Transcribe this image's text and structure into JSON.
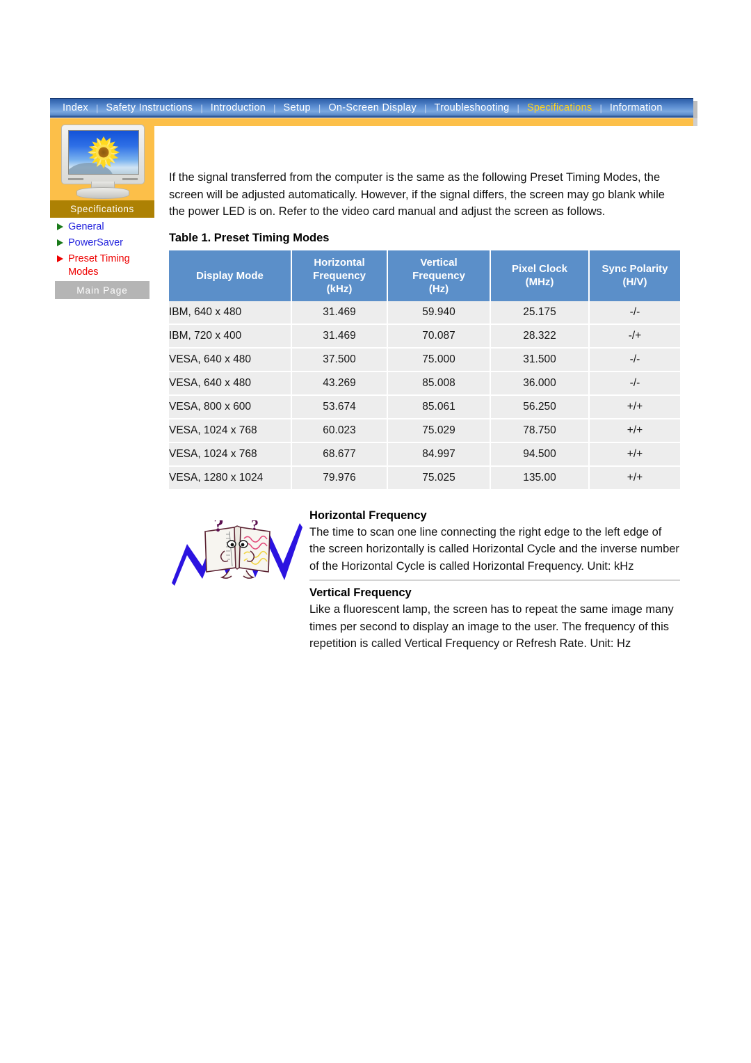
{
  "nav": {
    "items": [
      {
        "label": "Index",
        "active": false
      },
      {
        "label": "Safety Instructions",
        "active": false
      },
      {
        "label": "Introduction",
        "active": false
      },
      {
        "label": "Setup",
        "active": false
      },
      {
        "label": "On-Screen Display",
        "active": false
      },
      {
        "label": "Troubleshooting",
        "active": false
      },
      {
        "label": "Specifications",
        "active": true
      },
      {
        "label": "Information",
        "active": false
      }
    ],
    "separator": "|"
  },
  "sidebar": {
    "banner": "Specifications",
    "items": [
      {
        "label": "General",
        "current": false
      },
      {
        "label": "PowerSaver",
        "current": false
      },
      {
        "label": "Preset Timing Modes",
        "current": true
      }
    ],
    "main_page_button": "Main Page"
  },
  "main": {
    "intro": "If the signal transferred from the computer is the same as the following Preset Timing Modes, the screen will be adjusted automatically. However, if the signal differs, the screen may go blank while the power LED is on. Refer to the video card manual and adjust the screen as follows.",
    "table_title": "Table 1. Preset Timing Modes"
  },
  "table": {
    "headers": [
      {
        "line1": "Display Mode",
        "line2": "",
        "line3": ""
      },
      {
        "line1": "Horizontal",
        "line2": "Frequency",
        "line3": "(kHz)"
      },
      {
        "line1": "Vertical",
        "line2": "Frequency",
        "line3": "(Hz)"
      },
      {
        "line1": "Pixel Clock",
        "line2": "(MHz)",
        "line3": ""
      },
      {
        "line1": "Sync Polarity",
        "line2": "(H/V)",
        "line3": ""
      }
    ],
    "rows": [
      {
        "mode": "IBM, 640 x 480",
        "hf": "31.469",
        "vf": "59.940",
        "pc": "25.175",
        "sp": "-/-"
      },
      {
        "mode": "IBM, 720 x 400",
        "hf": "31.469",
        "vf": "70.087",
        "pc": "28.322",
        "sp": "-/+"
      },
      {
        "mode": "VESA, 640 x 480",
        "hf": "37.500",
        "vf": "75.000",
        "pc": "31.500",
        "sp": "-/-"
      },
      {
        "mode": "VESA, 640 x 480",
        "hf": "43.269",
        "vf": "85.008",
        "pc": "36.000",
        "sp": "-/-"
      },
      {
        "mode": "VESA, 800 x 600",
        "hf": "53.674",
        "vf": "85.061",
        "pc": "56.250",
        "sp": "+/+"
      },
      {
        "mode": "VESA, 1024 x 768",
        "hf": "60.023",
        "vf": "75.029",
        "pc": "78.750",
        "sp": "+/+"
      },
      {
        "mode": "VESA, 1024 x 768",
        "hf": "68.677",
        "vf": "84.997",
        "pc": "94.500",
        "sp": "+/+"
      },
      {
        "mode": "VESA, 1280 x 1024",
        "hf": "79.976",
        "vf": "75.025",
        "pc": "135.00",
        "sp": "+/+"
      }
    ]
  },
  "notes": {
    "horizontal": {
      "heading": "Horizontal Frequency",
      "body": "The time to scan one line connecting the right edge to the left edge of the screen horizontally is called Horizontal Cycle and the inverse number of the Horizontal Cycle is called Horizontal Frequency. Unit: kHz"
    },
    "vertical": {
      "heading": "Vertical Frequency",
      "body": "Like a fluorescent lamp, the screen has to repeat the same image many times per second to display an image to the user. The frequency of this repetition is called Vertical Frequency or Refresh Rate. Unit: Hz"
    }
  },
  "colors": {
    "nav_blue": "#3a6cb5",
    "nav_active": "#ffd21e",
    "sidebar_orange": "#fcbf49",
    "banner_gold": "#ad8104",
    "table_header_blue": "#5b8fc9",
    "table_row_gray": "#ededed",
    "link_blue": "#2222dd",
    "current_red": "#ee0000"
  }
}
